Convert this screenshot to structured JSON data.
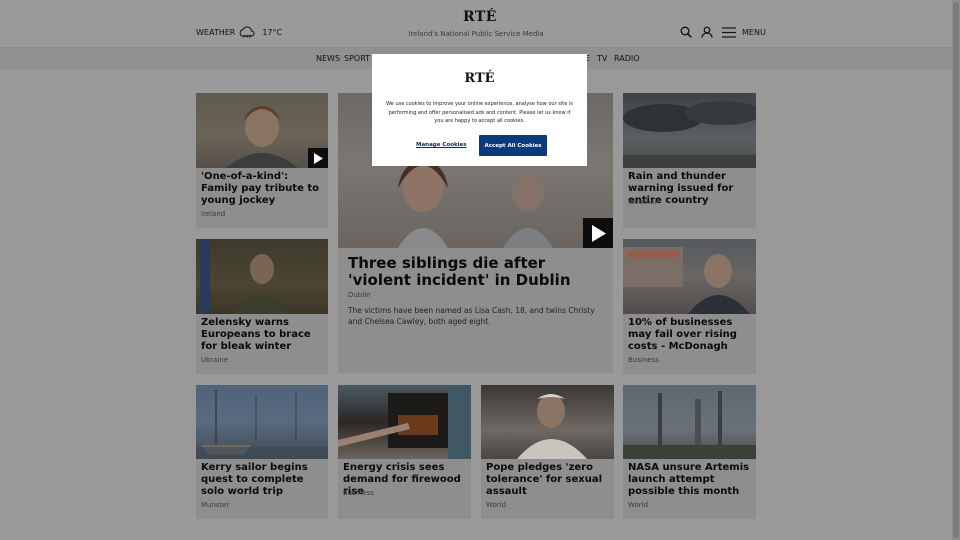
{
  "header": {
    "weather_label": "WEATHER",
    "temperature": "17°C",
    "logo": "RTÉ",
    "tagline": "Ireland's National Public Service Media",
    "menu_label": "MENU"
  },
  "nav": {
    "items": [
      "NEWS",
      "SPORT",
      "TV",
      "RADIO"
    ],
    "partial_item": "E"
  },
  "cards": {
    "jockey": {
      "title": "'One-of-a-kind': Family pay tribute to young jockey",
      "category": "Ireland"
    },
    "siblings": {
      "title": "Three siblings die after 'violent incident' in Dublin",
      "category": "Dublin",
      "summary": "The victims have been named as Lisa Cash, 18, and twins Christy and Chelsea Cawley, both aged eight."
    },
    "rain": {
      "title": "Rain and thunder warning issued for entire country",
      "category": "Weather"
    },
    "zelensky": {
      "title": "Zelensky warns Europeans to brace for bleak winter",
      "category": "Ukraine"
    },
    "business": {
      "title": "10% of businesses may fail over rising costs - McDonagh",
      "category": "Business"
    },
    "sailor": {
      "title": "Kerry sailor begins quest to complete solo world trip",
      "category": "Munster"
    },
    "firewood": {
      "title": "Energy crisis sees demand for firewood rise",
      "category": "Business"
    },
    "pope": {
      "title": "Pope pledges 'zero tolerance' for sexual assault",
      "category": "World"
    },
    "nasa": {
      "title": "NASA unsure Artemis launch attempt possible this month",
      "category": "World"
    }
  },
  "cookie_modal": {
    "logo": "RTÉ",
    "text": "We use cookies to improve your online experience, analyse how our site is performing and offer personalised ads and content. Please let us know if you are happy to accept all cookies.",
    "manage_label": "Manage Cookies",
    "accept_label": "Accept All Cookies"
  },
  "colors": {
    "accent_button": "#0a3a7a",
    "manage_link": "#0b2d6b"
  },
  "icons": [
    "weather-icon",
    "search-icon",
    "user-icon",
    "hamburger-icon",
    "play-icon"
  ]
}
